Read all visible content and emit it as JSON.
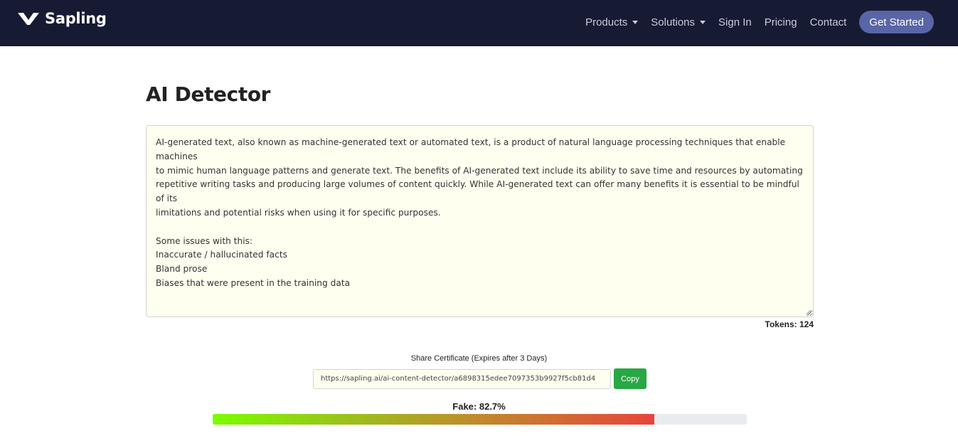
{
  "header": {
    "brand": "Sapling",
    "nav": [
      {
        "label": "Products",
        "dropdown": true
      },
      {
        "label": "Solutions",
        "dropdown": true
      },
      {
        "label": "Sign In",
        "dropdown": false
      },
      {
        "label": "Pricing",
        "dropdown": false
      },
      {
        "label": "Contact",
        "dropdown": false
      }
    ],
    "cta": "Get Started"
  },
  "main": {
    "title": "AI Detector",
    "text_lines": [
      "AI-generated text, also known as machine-generated text or automated text, is a product of natural language processing techniques that enable machines",
      "to mimic human language patterns and generate text. The benefits of AI-generated text include its ability to save time and resources by automating",
      "repetitive writing tasks and producing large volumes of content quickly. While AI-generated text can offer many benefits it is essential to be mindful of its",
      "limitations and potential risks when using it for specific purposes.",
      "",
      "Some issues with this:",
      "Inaccurate / hallucinated facts",
      "Bland prose",
      "Biases that were present in the training data"
    ],
    "tokens_label": "Tokens: 124",
    "share": {
      "label": "Share Certificate (Expires after 3 Days)",
      "url": "https://sapling.ai/ai-content-detector/a6898315edee7097353b9927f5cb81d4",
      "copy_label": "Copy"
    },
    "result": {
      "label": "Fake: 82.7%",
      "fake_fraction": 0.827
    }
  },
  "colors": {
    "navbar_bg": "#161a33",
    "cta_bg": "#5965a6",
    "copy_bg": "#28a745",
    "editor_bg": "#fffff0",
    "bar_start": "#7cfc00",
    "bar_end": "#e8453c"
  },
  "icons": {
    "brand_logo": "sapling-logo-icon",
    "dropdown": "caret-down-icon"
  }
}
